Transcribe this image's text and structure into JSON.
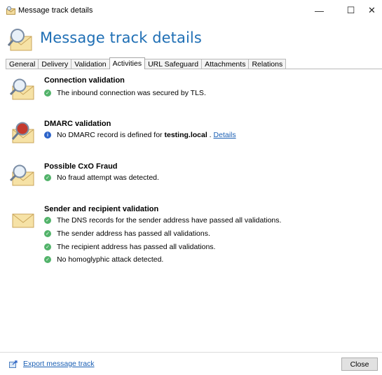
{
  "window": {
    "title": "Message track details",
    "controls": {
      "minimize": "—",
      "maximize": "☐",
      "close": "✕"
    }
  },
  "header": {
    "title": "Message track details"
  },
  "tabs": [
    {
      "label": "General"
    },
    {
      "label": "Delivery"
    },
    {
      "label": "Validation"
    },
    {
      "label": "Activities",
      "active": true
    },
    {
      "label": "URL Safeguard"
    },
    {
      "label": "Attachments"
    },
    {
      "label": "Relations"
    }
  ],
  "sections": {
    "connection": {
      "title": "Connection validation",
      "items": [
        {
          "text": "The inbound connection was secured by TLS.",
          "status": "ok"
        }
      ]
    },
    "dmarc": {
      "title": "DMARC validation",
      "item": {
        "prefix": "No DMARC record is defined for ",
        "domain": "testing.local",
        "suffix": " . ",
        "link": "Details",
        "status": "info"
      }
    },
    "fraud": {
      "title": "Possible CxO Fraud",
      "items": [
        {
          "text": "No fraud attempt was detected.",
          "status": "ok"
        }
      ]
    },
    "sender": {
      "title": "Sender and recipient validation",
      "items": [
        {
          "text": "The DNS records for the sender address have passed all validations.",
          "status": "ok"
        },
        {
          "text": "The sender address has passed all validations.",
          "status": "ok"
        },
        {
          "text": "The recipient address has passed all validations.",
          "status": "ok"
        },
        {
          "text": "No homoglyphic attack detected.",
          "status": "ok"
        }
      ]
    }
  },
  "footer": {
    "export_label": "Export message track",
    "close_label": "Close"
  },
  "colors": {
    "heading": "#1f6fb5",
    "ok": "#52b36a",
    "info": "#2b63c9",
    "link": "#1a5fb4"
  }
}
